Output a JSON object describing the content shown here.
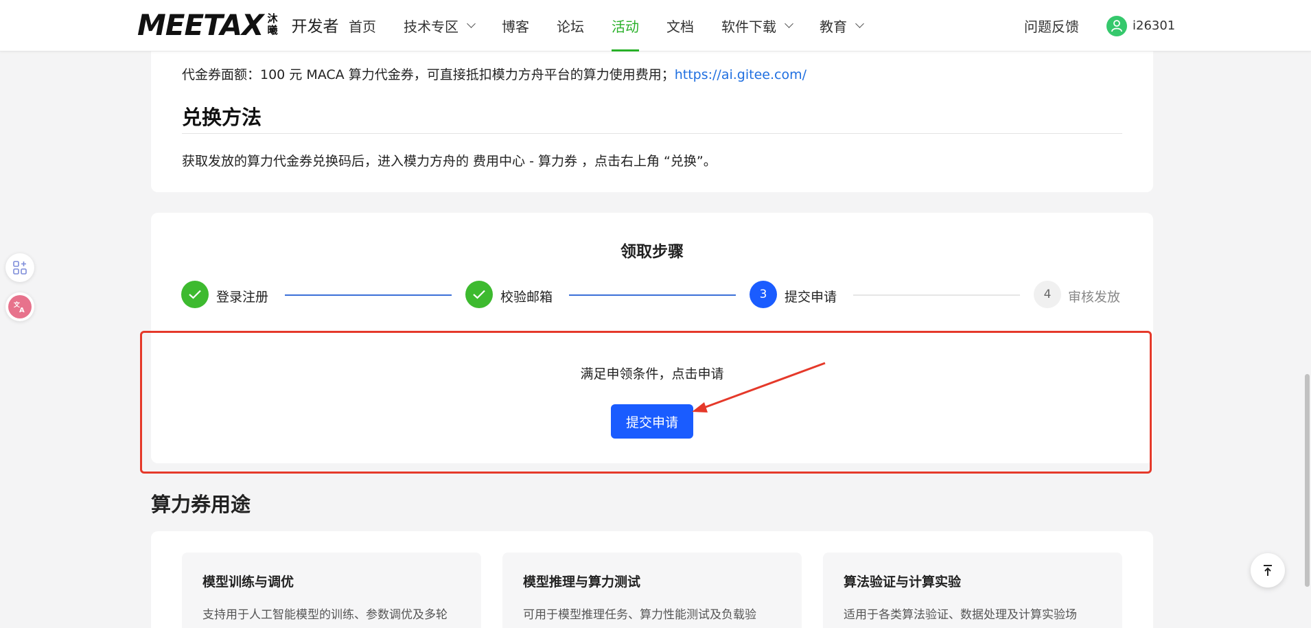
{
  "header": {
    "logo_text": "MEETAX",
    "logo_cn_top": "沐",
    "logo_cn_bottom": "曦",
    "site_label": "开发者",
    "nav": [
      {
        "label": "首页",
        "dropdown": false,
        "active": false
      },
      {
        "label": "技术专区",
        "dropdown": true,
        "active": false
      },
      {
        "label": "博客",
        "dropdown": false,
        "active": false
      },
      {
        "label": "论坛",
        "dropdown": false,
        "active": false
      },
      {
        "label": "活动",
        "dropdown": false,
        "active": true
      },
      {
        "label": "文档",
        "dropdown": false,
        "active": false
      },
      {
        "label": "软件下载",
        "dropdown": true,
        "active": false
      },
      {
        "label": "教育",
        "dropdown": true,
        "active": false
      }
    ],
    "feedback": "问题反馈",
    "username": "i26301"
  },
  "voucher": {
    "amount_text": "代金券面额：100 元 MACA 算力代金券，可直接抵扣模力方舟平台的算力使用费用；",
    "link": "https://ai.gitee.com/"
  },
  "redeem": {
    "title": "兑换方法",
    "text": "获取发放的算力代金券兑换码后，进入模力方舟的 费用中心 - 算力券 ，点击右上角 “兑换”。"
  },
  "steps": {
    "title": "领取步骤",
    "items": [
      {
        "label": "登录注册",
        "status": "done",
        "num": "1"
      },
      {
        "label": "校验邮箱",
        "status": "done",
        "num": "2"
      },
      {
        "label": "提交申请",
        "status": "current",
        "num": "3"
      },
      {
        "label": "审核发放",
        "status": "todo",
        "num": "4"
      }
    ]
  },
  "apply": {
    "prompt": "满足申领条件，点击申请",
    "button": "提交申请"
  },
  "usage": {
    "title": "算力券用途",
    "items": [
      {
        "title": "模型训练与调优",
        "desc": "支持用于人工智能模型的训练、参数调优及多轮"
      },
      {
        "title": "模型推理与算力测试",
        "desc": "可用于模型推理任务、算力性能测试及负载验"
      },
      {
        "title": "算法验证与计算实验",
        "desc": "适用于各类算法验证、数据处理及计算实验场"
      }
    ]
  },
  "colors": {
    "active_nav": "#28b028",
    "primary": "#1a5cff",
    "done": "#3dba2f",
    "highlight": "#e5392a",
    "link": "#1f6fe0"
  }
}
